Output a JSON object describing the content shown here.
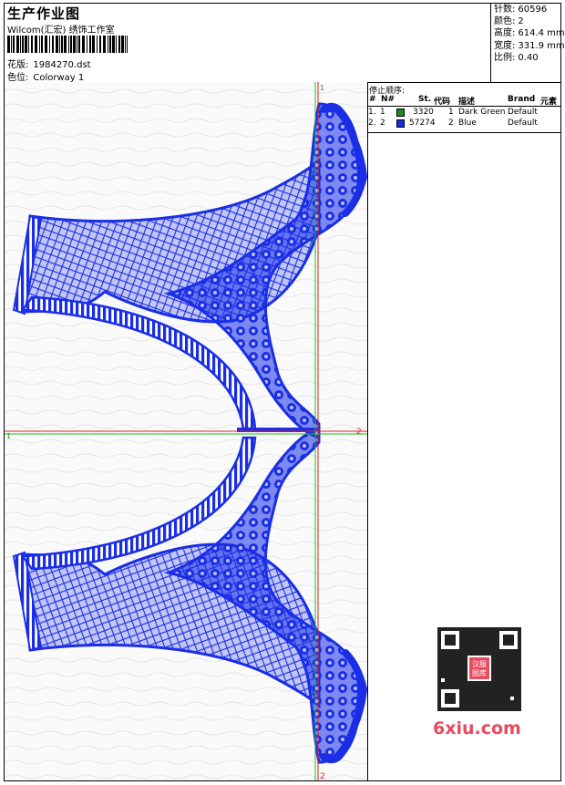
{
  "header": {
    "title": "生产作业图",
    "company": "Wilcom(汇宏) 绣饰工作室",
    "design_label": "花版:",
    "design_value": "1984270.dst",
    "colorway_label": "色位:",
    "colorway_value": "Colorway 1"
  },
  "stats": [
    {
      "label": "针数:",
      "value": "60596"
    },
    {
      "label": "颜色:",
      "value": "2"
    },
    {
      "label": "高度:",
      "value": "614.4 mm"
    },
    {
      "label": "宽度:",
      "value": "331.9 mm"
    },
    {
      "label": "比例:",
      "value": "0.40"
    }
  ],
  "stop_sequence": {
    "title": "停止顺序:",
    "columns": [
      "#",
      "N#",
      "St.",
      "代码",
      "描述",
      "Brand",
      "元素"
    ],
    "rows": [
      {
        "index": "1.",
        "n": "1",
        "color": "#1e8a2a",
        "stitches": "3320",
        "code": "1",
        "description": "Dark Green",
        "brand": "Default"
      },
      {
        "index": "2.",
        "n": "2",
        "color": "#1530e0",
        "stitches": "57274",
        "code": "2",
        "description": "Blue",
        "brand": "Default"
      }
    ]
  },
  "markers": {
    "v_top": "1",
    "v_bottom": "2",
    "h_left": "1",
    "h_right": "2"
  },
  "colors": {
    "embroidery_blue": "#1a2ee6",
    "guide_green": "#22c022",
    "guide_red": "#e02020"
  },
  "watermark": "6xiu.com",
  "qr_badge": "汉服\n图库"
}
